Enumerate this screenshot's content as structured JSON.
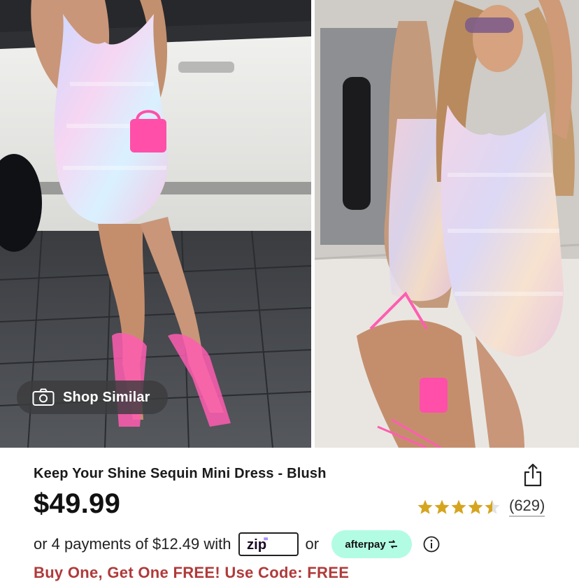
{
  "gallery": {
    "images": [
      {
        "icon": "model-photo-street"
      },
      {
        "icon": "model-photo-mirror"
      }
    ],
    "shop_similar_label": "Shop Similar",
    "shop_similar_icon": "camera-icon"
  },
  "product": {
    "title": "Keep Your Shine Sequin Mini Dress - Blush",
    "price": "$49.99",
    "rating": {
      "stars": 4.5,
      "max": 5,
      "count_label": "(629)",
      "star_color": "#d6a51f"
    },
    "share_icon": "share-icon"
  },
  "payments": {
    "prefix": "or 4 payments of $12.49 with",
    "zip_label": "zip",
    "separator": "or",
    "afterpay_label": "afterpay",
    "afterpay_color": "#b2fce4",
    "info_icon": "info-icon"
  },
  "promo": {
    "text": "Buy One, Get One FREE! Use Code: FREE",
    "color": "#b03a3a"
  }
}
